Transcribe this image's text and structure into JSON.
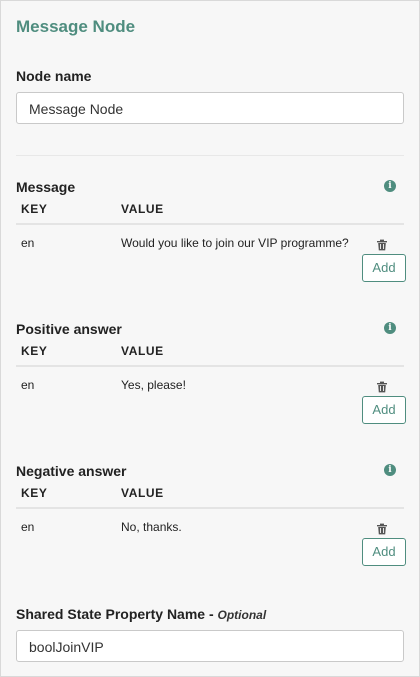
{
  "panel": {
    "title": "Message Node",
    "node_name_label": "Node name",
    "node_name_value": "Message Node"
  },
  "table_headers": {
    "key": "KEY",
    "value": "VALUE"
  },
  "sections": [
    {
      "label": "Message",
      "row": {
        "key": "en",
        "value": "Would you like to join our VIP programme?"
      },
      "add_label": "Add"
    },
    {
      "label": "Positive answer",
      "row": {
        "key": "en",
        "value": "Yes, please!"
      },
      "add_label": "Add"
    },
    {
      "label": "Negative answer",
      "row": {
        "key": "en",
        "value": "No, thanks."
      },
      "add_label": "Add"
    }
  ],
  "shared_state": {
    "label": "Shared State Property Name - ",
    "optional": "Optional",
    "value": "boolJoinVIP"
  },
  "icons": {
    "info": "info-icon",
    "delete": "trash-icon"
  },
  "colors": {
    "accent": "#4f8d7f",
    "panel_bg": "#f7f7f7"
  }
}
